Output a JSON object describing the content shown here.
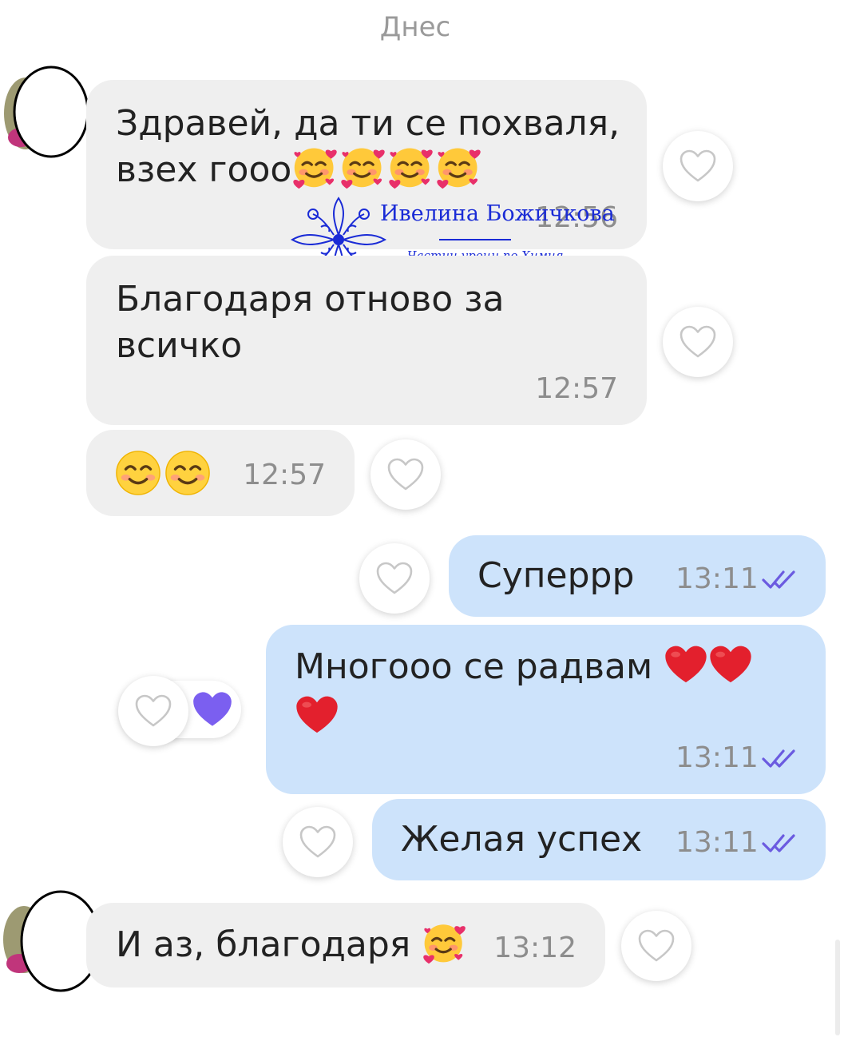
{
  "header": {
    "date_label": "Днес"
  },
  "messages": [
    {
      "text": "Здравей, да ти се похваля,\nвзех гооо",
      "time": "12:56",
      "direction": "incoming",
      "emoji": "smiling-face-with-hearts-x4"
    },
    {
      "text": "Благодаря отново за\nвсичко",
      "time": "12:57",
      "direction": "incoming"
    },
    {
      "text": "",
      "time": "12:57",
      "direction": "incoming",
      "emoji": "smiling-face-x2"
    },
    {
      "text": "Суперрр",
      "time": "13:11",
      "direction": "outgoing",
      "status": "read"
    },
    {
      "text": "Многооо се радвам",
      "time": "13:11",
      "direction": "outgoing",
      "status": "read",
      "emoji": "red-heart-x3",
      "reaction": "purple-heart"
    },
    {
      "text": "Желая успех",
      "time": "13:11",
      "direction": "outgoing",
      "status": "read"
    },
    {
      "text": "И аз, благодаря",
      "time": "13:12",
      "direction": "incoming",
      "emoji": "smiling-face-with-hearts"
    }
  ],
  "watermark": {
    "name": "Ивелина Божичкова",
    "subtitle": "Частни уроци по Химия"
  },
  "colors": {
    "incoming_bubble": "#efefef",
    "outgoing_bubble": "#cde3fb",
    "read_ticks": "#6b5be0",
    "reaction_heart": "#7b5ff0",
    "watermark": "#1a2bd6"
  }
}
